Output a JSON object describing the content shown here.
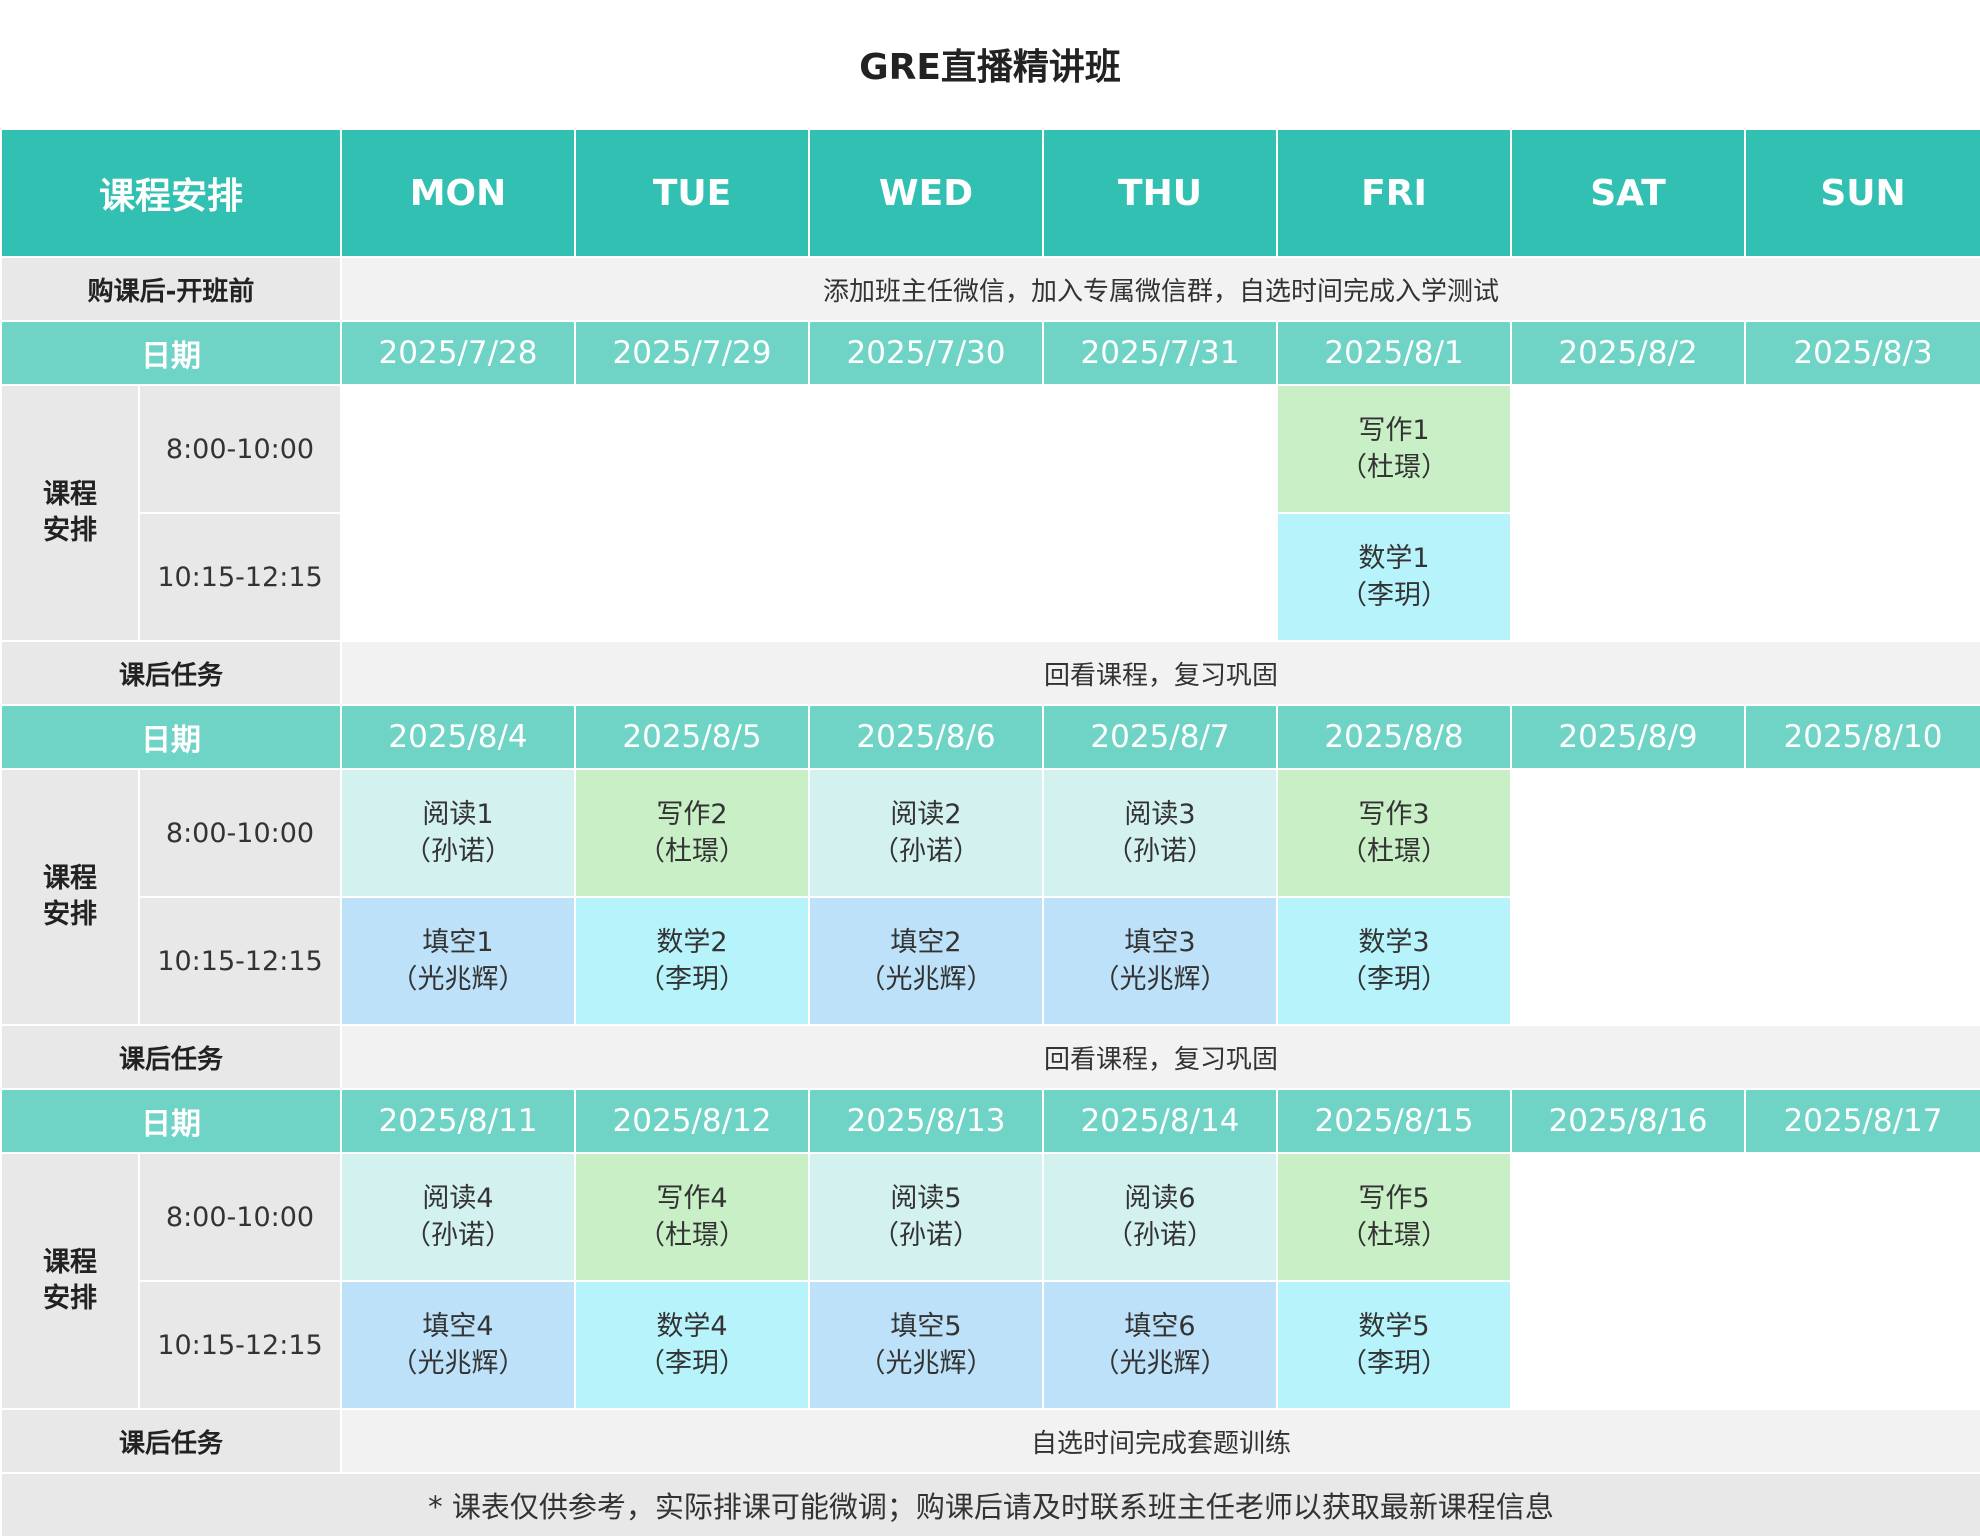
{
  "title": "GRE直播精讲班",
  "header": {
    "corner": "课程安排",
    "days": [
      "MON",
      "TUE",
      "WED",
      "THU",
      "FRI",
      "SAT",
      "SUN"
    ]
  },
  "pre": {
    "label": "购课后-开班前",
    "text": "添加班主任微信，加入专属微信群，自选时间完成入学测试"
  },
  "labels": {
    "date": "日期",
    "section": "课程安排",
    "slot1": "8:00-10:00",
    "slot2": "10:15-12:15",
    "task": "课后任务"
  },
  "weeks": [
    {
      "dates": [
        "2025/7/28",
        "2025/7/29",
        "2025/7/30",
        "2025/7/31",
        "2025/8/1",
        "2025/8/2",
        "2025/8/3"
      ],
      "slot1": [
        null,
        null,
        null,
        null,
        {
          "name": "写作1",
          "teacher": "（杜璟）",
          "type": "write"
        },
        null,
        null
      ],
      "slot2": [
        null,
        null,
        null,
        null,
        {
          "name": "数学1",
          "teacher": "（李玥）",
          "type": "math"
        },
        null,
        null
      ],
      "task": "回看课程，复习巩固"
    },
    {
      "dates": [
        "2025/8/4",
        "2025/8/5",
        "2025/8/6",
        "2025/8/7",
        "2025/8/8",
        "2025/8/9",
        "2025/8/10"
      ],
      "slot1": [
        {
          "name": "阅读1",
          "teacher": "（孙诺）",
          "type": "read"
        },
        {
          "name": "写作2",
          "teacher": "（杜璟）",
          "type": "write"
        },
        {
          "name": "阅读2",
          "teacher": "（孙诺）",
          "type": "read"
        },
        {
          "name": "阅读3",
          "teacher": "（孙诺）",
          "type": "read"
        },
        {
          "name": "写作3",
          "teacher": "（杜璟）",
          "type": "write"
        },
        null,
        null
      ],
      "slot2": [
        {
          "name": "填空1",
          "teacher": "（光兆辉）",
          "type": "fill"
        },
        {
          "name": "数学2",
          "teacher": "（李玥）",
          "type": "math"
        },
        {
          "name": "填空2",
          "teacher": "（光兆辉）",
          "type": "fill"
        },
        {
          "name": "填空3",
          "teacher": "（光兆辉）",
          "type": "fill"
        },
        {
          "name": "数学3",
          "teacher": "（李玥）",
          "type": "math"
        },
        null,
        null
      ],
      "task": "回看课程，复习巩固"
    },
    {
      "dates": [
        "2025/8/11",
        "2025/8/12",
        "2025/8/13",
        "2025/8/14",
        "2025/8/15",
        "2025/8/16",
        "2025/8/17"
      ],
      "slot1": [
        {
          "name": "阅读4",
          "teacher": "（孙诺）",
          "type": "read"
        },
        {
          "name": "写作4",
          "teacher": "（杜璟）",
          "type": "write"
        },
        {
          "name": "阅读5",
          "teacher": "（孙诺）",
          "type": "read"
        },
        {
          "name": "阅读6",
          "teacher": "（孙诺）",
          "type": "read"
        },
        {
          "name": "写作5",
          "teacher": "（杜璟）",
          "type": "write"
        },
        null,
        null
      ],
      "slot2": [
        {
          "name": "填空4",
          "teacher": "（光兆辉）",
          "type": "fill"
        },
        {
          "name": "数学4",
          "teacher": "（李玥）",
          "type": "math"
        },
        {
          "name": "填空5",
          "teacher": "（光兆辉）",
          "type": "fill"
        },
        {
          "name": "填空6",
          "teacher": "（光兆辉）",
          "type": "fill"
        },
        {
          "name": "数学5",
          "teacher": "（李玥）",
          "type": "math"
        },
        null,
        null
      ],
      "task": "自选时间完成套题训练"
    }
  ],
  "note": "* 课表仅供参考，实际排课可能微调；购课后请及时联系班主任老师以获取最新课程信息",
  "colors": {
    "header": "#31c0b2",
    "date_row": "#6fd4c5",
    "label_bg": "#e9e8e9",
    "row_bg": "#f2f2f2",
    "read": "#d3f1ef",
    "write": "#c8efc6",
    "fill": "#bde1f8",
    "math": "#b7f3fb"
  }
}
